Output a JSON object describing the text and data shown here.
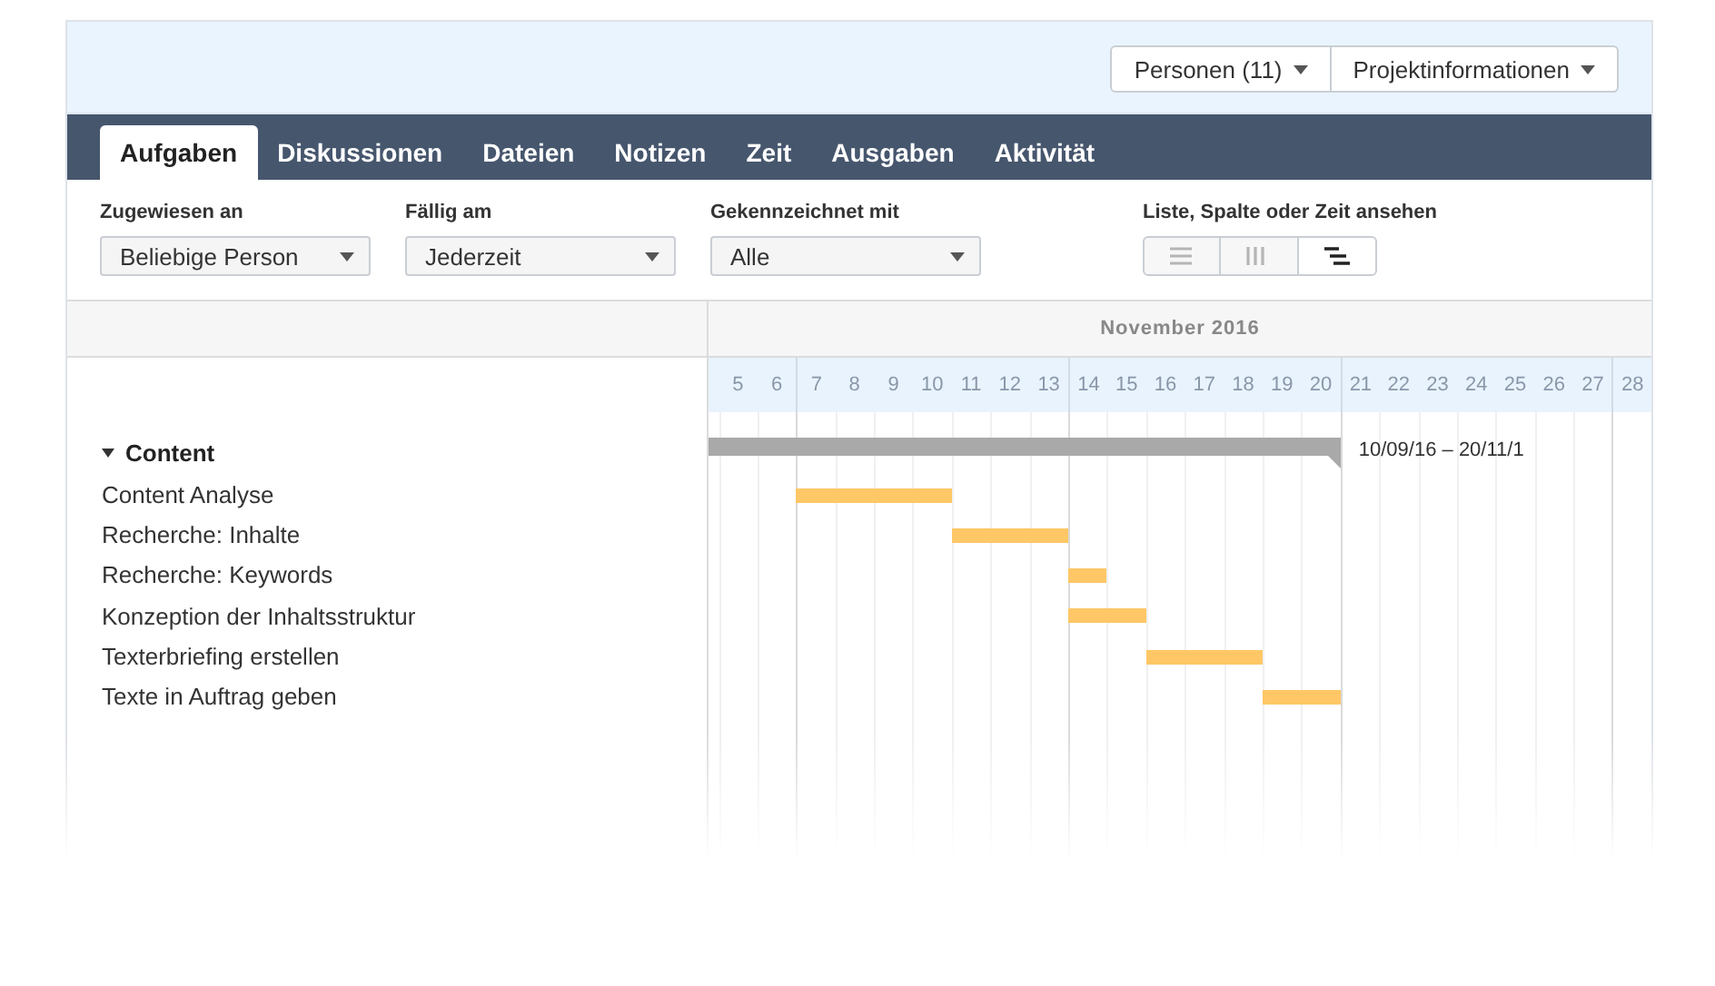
{
  "header": {
    "buttons": [
      {
        "label": "Personen (11)"
      },
      {
        "label": "Projektinformationen"
      }
    ]
  },
  "tabs": [
    {
      "label": "Aufgaben",
      "selected": true
    },
    {
      "label": "Diskussionen",
      "selected": false
    },
    {
      "label": "Dateien",
      "selected": false
    },
    {
      "label": "Notizen",
      "selected": false
    },
    {
      "label": "Zeit",
      "selected": false
    },
    {
      "label": "Ausgaben",
      "selected": false
    },
    {
      "label": "Aktivität",
      "selected": false
    }
  ],
  "filters": [
    {
      "label": "Zugewiesen an",
      "value": "Beliebige Person"
    },
    {
      "label": "Fällig am",
      "value": "Jederzeit"
    },
    {
      "label": "Gekennzeichnet mit",
      "value": "Alle"
    }
  ],
  "view_switch": {
    "label": "Liste, Spalte oder Zeit ansehen",
    "options": [
      {
        "kind": "list",
        "selected": false
      },
      {
        "kind": "columns",
        "selected": false
      },
      {
        "kind": "timeline",
        "selected": true
      }
    ]
  },
  "gantt": {
    "month": "November 2016",
    "days": [
      {
        "label": "5",
        "week_start": false
      },
      {
        "label": "6",
        "week_start": false
      },
      {
        "label": "7",
        "week_start": true
      },
      {
        "label": "8",
        "week_start": false
      },
      {
        "label": "9",
        "week_start": false
      },
      {
        "label": "10",
        "week_start": false
      },
      {
        "label": "11",
        "week_start": false
      },
      {
        "label": "12",
        "week_start": false
      },
      {
        "label": "13",
        "week_start": false
      },
      {
        "label": "14",
        "week_start": true
      },
      {
        "label": "15",
        "week_start": false
      },
      {
        "label": "16",
        "week_start": false
      },
      {
        "label": "17",
        "week_start": false
      },
      {
        "label": "18",
        "week_start": false
      },
      {
        "label": "19",
        "week_start": false
      },
      {
        "label": "20",
        "week_start": false
      },
      {
        "label": "21",
        "week_start": true
      },
      {
        "label": "22",
        "week_start": false
      },
      {
        "label": "23",
        "week_start": false
      },
      {
        "label": "24",
        "week_start": false
      },
      {
        "label": "25",
        "week_start": false
      },
      {
        "label": "26",
        "week_start": false
      },
      {
        "label": "27",
        "week_start": false
      },
      {
        "label": "28",
        "week_start": true
      }
    ],
    "groups": [
      {
        "name": "Content",
        "expanded": true,
        "date_range": "10/09/16 – 20/11/1",
        "schedule": [
          true,
          true,
          true,
          true,
          true,
          true,
          true,
          true,
          true,
          true,
          true,
          true,
          true,
          true,
          true,
          true,
          false,
          false,
          false,
          false,
          false,
          false,
          false,
          false
        ],
        "children": [
          {
            "name": "Content Analyse",
            "schedule": [
              false,
              false,
              true,
              true,
              true,
              true,
              false,
              false,
              false,
              false,
              false,
              false,
              false,
              false,
              false,
              false,
              false,
              false,
              false,
              false,
              false,
              false,
              false,
              false
            ]
          },
          {
            "name": "Recherche: Inhalte",
            "schedule": [
              false,
              false,
              false,
              false,
              false,
              false,
              true,
              true,
              true,
              false,
              false,
              false,
              false,
              false,
              false,
              false,
              false,
              false,
              false,
              false,
              false,
              false,
              false,
              false
            ]
          },
          {
            "name": "Recherche: Keywords",
            "schedule": [
              false,
              false,
              false,
              false,
              false,
              false,
              false,
              false,
              false,
              true,
              false,
              false,
              false,
              false,
              false,
              false,
              false,
              false,
              false,
              false,
              false,
              false,
              false,
              false
            ]
          },
          {
            "name": "Konzeption der Inhaltsstruktur",
            "schedule": [
              false,
              false,
              false,
              false,
              false,
              false,
              false,
              false,
              false,
              true,
              true,
              false,
              false,
              false,
              false,
              false,
              false,
              false,
              false,
              false,
              false,
              false,
              false,
              false
            ]
          },
          {
            "name": "Texterbriefing erstellen",
            "schedule": [
              false,
              false,
              false,
              false,
              false,
              false,
              false,
              false,
              false,
              false,
              false,
              true,
              true,
              true,
              false,
              false,
              false,
              false,
              false,
              false,
              false,
              false,
              false,
              false
            ]
          },
          {
            "name": "Texte in Auftrag geben",
            "schedule": [
              false,
              false,
              false,
              false,
              false,
              false,
              false,
              false,
              false,
              false,
              false,
              false,
              false,
              false,
              true,
              true,
              false,
              false,
              false,
              false,
              false,
              false,
              false,
              false
            ]
          }
        ]
      }
    ]
  }
}
